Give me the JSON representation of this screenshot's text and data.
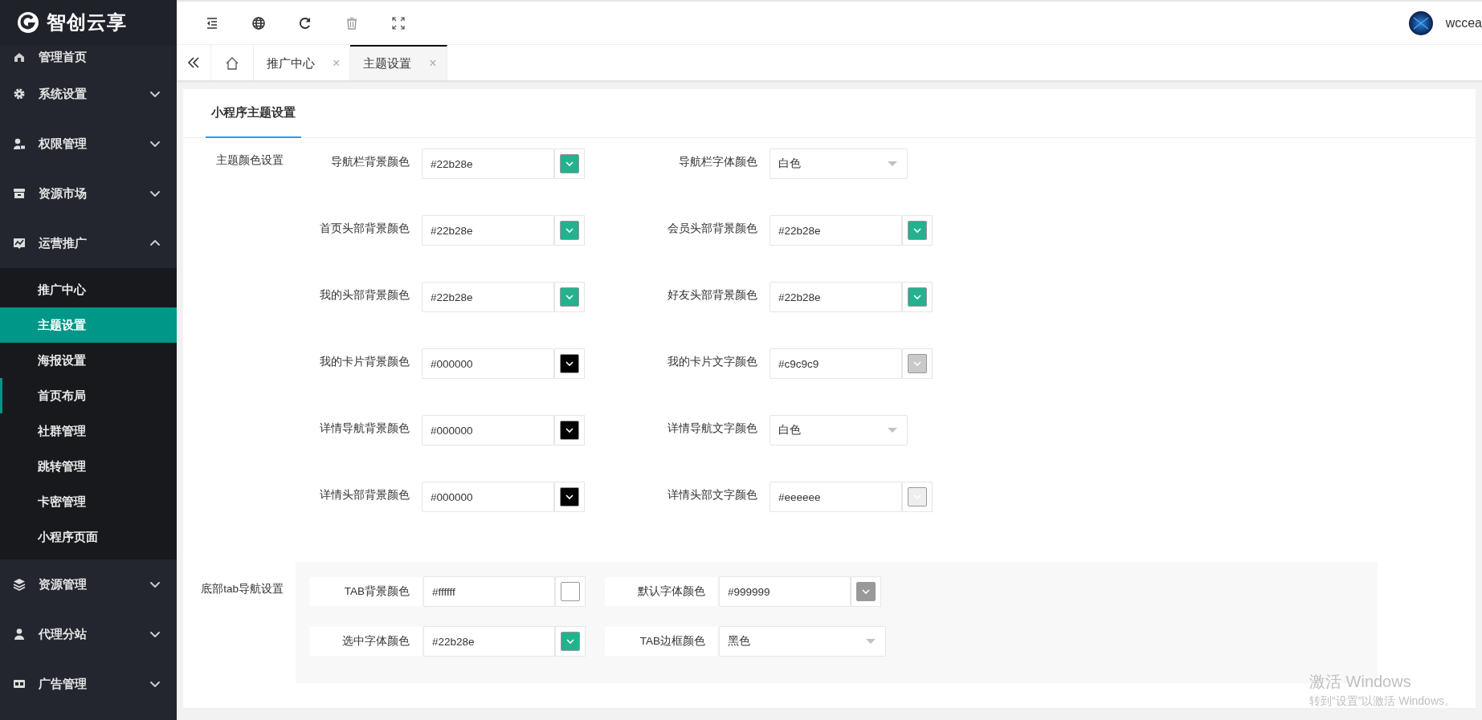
{
  "sidebar": {
    "logo": "智创云享",
    "items": [
      {
        "kind": "link",
        "label": "管理首页"
      },
      {
        "kind": "group",
        "label": "系统设置",
        "expanded": false
      },
      {
        "kind": "group",
        "label": "权限管理",
        "expanded": false
      },
      {
        "kind": "group",
        "label": "资源市场",
        "expanded": false
      },
      {
        "kind": "group",
        "label": "运营推广",
        "expanded": true,
        "children": [
          {
            "label": "推广中心",
            "selected": false,
            "highlighted": false
          },
          {
            "label": "主题设置",
            "selected": true,
            "highlighted": false
          },
          {
            "label": "海报设置",
            "selected": false,
            "highlighted": false
          },
          {
            "label": "首页布局",
            "selected": false,
            "highlighted": true
          },
          {
            "label": "社群管理",
            "selected": false,
            "highlighted": false
          },
          {
            "label": "跳转管理",
            "selected": false,
            "highlighted": false
          },
          {
            "label": "卡密管理",
            "selected": false,
            "highlighted": false
          },
          {
            "label": "小程序页面",
            "selected": false,
            "highlighted": false
          }
        ]
      },
      {
        "kind": "group",
        "label": "资源管理",
        "expanded": false
      },
      {
        "kind": "group",
        "label": "代理分站",
        "expanded": false
      },
      {
        "kind": "group",
        "label": "广告管理",
        "expanded": false
      }
    ]
  },
  "user": {
    "name": "wccea"
  },
  "tabs": [
    {
      "kind": "home",
      "selected": false
    },
    {
      "kind": "page",
      "label": "推广中心",
      "close": "×",
      "selected": false
    },
    {
      "kind": "page",
      "label": "主题设置",
      "close": "×",
      "selected": true
    }
  ],
  "card": {
    "tabs": [
      {
        "label": "小程序主题设置",
        "selected": true
      }
    ],
    "sections": [
      {
        "kind": "plain",
        "label": "主题颜色设置",
        "rows": [
          [
            {
              "label": "导航栏背景颜色",
              "kind": "color",
              "value": "#22b28e",
              "color": "#22b28e"
            },
            {
              "label": "导航栏字体颜色",
              "kind": "select",
              "value": "白色"
            }
          ],
          [
            {
              "label": "首页头部背景颜色",
              "kind": "color",
              "value": "#22b28e",
              "color": "#22b28e"
            },
            {
              "label": "会员头部背景颜色",
              "kind": "color",
              "value": "#22b28e",
              "color": "#22b28e"
            }
          ],
          [
            {
              "label": "我的头部背景颜色",
              "kind": "color",
              "value": "#22b28e",
              "color": "#22b28e"
            },
            {
              "label": "好友头部背景颜色",
              "kind": "color",
              "value": "#22b28e",
              "color": "#22b28e"
            }
          ],
          [
            {
              "label": "我的卡片背景颜色",
              "kind": "color",
              "value": "#000000",
              "color": "#000000"
            },
            {
              "label": "我的卡片文字颜色",
              "kind": "color",
              "value": "#c9c9c9",
              "color": "#c9c9c9"
            }
          ],
          [
            {
              "label": "详情导航背景颜色",
              "kind": "color",
              "value": "#000000",
              "color": "#000000"
            },
            {
              "label": "详情导航文字颜色",
              "kind": "select",
              "value": "白色"
            }
          ],
          [
            {
              "label": "详情头部背景颜色",
              "kind": "color",
              "value": "#000000",
              "color": "#000000"
            },
            {
              "label": "详情头部文字颜色",
              "kind": "color",
              "value": "#eeeeee",
              "color": "#eeeeee"
            }
          ]
        ]
      },
      {
        "kind": "boxed",
        "label": "底部tab导航设置",
        "rows": [
          [
            {
              "label": "TAB背景颜色",
              "kind": "color",
              "value": "#ffffff",
              "color": "#ffffff"
            },
            {
              "label": "默认字体颜色",
              "kind": "color",
              "value": "#999999",
              "color": "#999999"
            }
          ],
          [
            {
              "label": "选中字体颜色",
              "kind": "color",
              "value": "#22b28e",
              "color": "#22b28e"
            },
            {
              "label": "TAB边框颜色",
              "kind": "select",
              "value": "黑色"
            }
          ]
        ]
      }
    ]
  },
  "os_notice": {
    "title": "激活 Windows",
    "text": "转到“设置”以激活 Windows。"
  }
}
